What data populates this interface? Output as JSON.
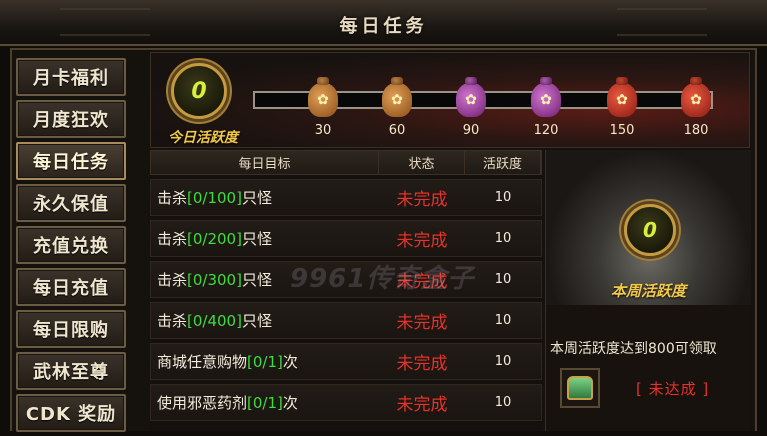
{
  "window": {
    "title": "每日任务"
  },
  "sidebar": {
    "items": [
      {
        "label": "月卡福利"
      },
      {
        "label": "月度狂欢"
      },
      {
        "label": "每日任务",
        "active": true
      },
      {
        "label": "永久保值"
      },
      {
        "label": "充值兑换"
      },
      {
        "label": "每日充值"
      },
      {
        "label": "每日限购"
      },
      {
        "label": "武林至尊"
      },
      {
        "label": "CDK 奖励"
      }
    ]
  },
  "daily": {
    "value": "0",
    "label": "今日活跃度",
    "progress": 0,
    "milestones": [
      {
        "value": "30",
        "bag_color": "brown"
      },
      {
        "value": "60",
        "bag_color": "brown"
      },
      {
        "value": "90",
        "bag_color": "purple"
      },
      {
        "value": "120",
        "bag_color": "purple"
      },
      {
        "value": "150",
        "bag_color": "red"
      },
      {
        "value": "180",
        "bag_color": "red"
      }
    ]
  },
  "table": {
    "headers": {
      "goal": "每日目标",
      "status": "状态",
      "points": "活跃度"
    },
    "rows": [
      {
        "pre": "击杀",
        "count": "[0/100]",
        "post": "只怪",
        "status": "未完成",
        "points": "10"
      },
      {
        "pre": "击杀",
        "count": "[0/200]",
        "post": "只怪",
        "status": "未完成",
        "points": "10"
      },
      {
        "pre": "击杀",
        "count": "[0/300]",
        "post": "只怪",
        "status": "未完成",
        "points": "10"
      },
      {
        "pre": "击杀",
        "count": "[0/400]",
        "post": "只怪",
        "status": "未完成",
        "points": "10"
      },
      {
        "pre": "商城任意购物",
        "count": "[0/1]",
        "post": "次",
        "status": "未完成",
        "points": "10"
      },
      {
        "pre": "使用邪恶药剂",
        "count": "[0/1]",
        "post": "次",
        "status": "未完成",
        "points": "10"
      }
    ]
  },
  "weekly": {
    "value": "0",
    "label": "本周活跃度",
    "info": "本周活跃度达到800可领取",
    "status": "[ 未达成 ]"
  },
  "watermark": "9961传奇盒子",
  "colors": {
    "accent_gold": "#f2c94a",
    "status_red": "#e5322a",
    "progress_green": "#3fdc3f"
  }
}
